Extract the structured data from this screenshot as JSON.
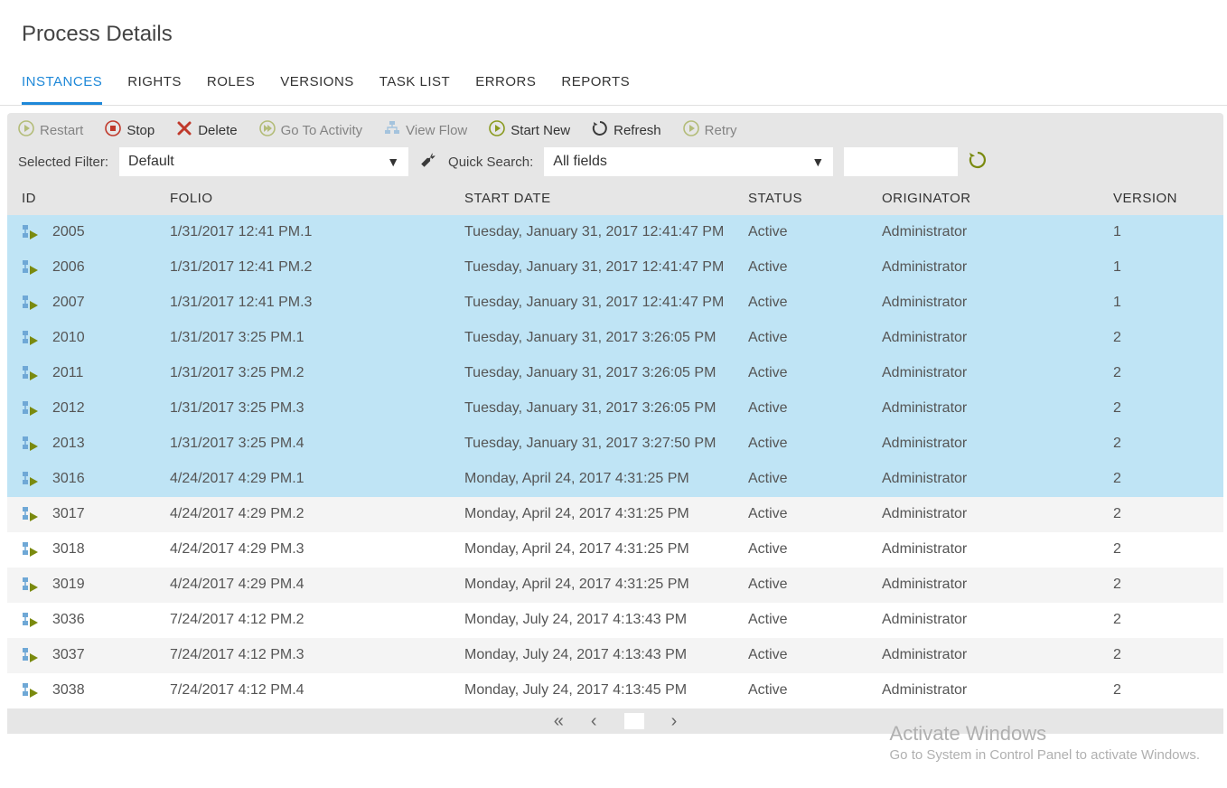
{
  "title": "Process Details",
  "tabs": [
    "INSTANCES",
    "RIGHTS",
    "ROLES",
    "VERSIONS",
    "TASK LIST",
    "ERRORS",
    "REPORTS"
  ],
  "activeTab": 0,
  "toolbar": {
    "restart": "Restart",
    "stop": "Stop",
    "delete": "Delete",
    "goto": "Go To Activity",
    "viewflow": "View Flow",
    "startnew": "Start New",
    "refresh": "Refresh",
    "retry": "Retry"
  },
  "filter": {
    "label": "Selected Filter:",
    "value": "Default"
  },
  "search": {
    "label": "Quick Search:",
    "fieldValue": "All fields",
    "inputValue": ""
  },
  "columns": {
    "id": "ID",
    "folio": "FOLIO",
    "start": "START DATE",
    "status": "STATUS",
    "originator": "ORIGINATOR",
    "version": "VERSION"
  },
  "rows": [
    {
      "id": "2005",
      "folio": "1/31/2017 12:41 PM.1",
      "start": "Tuesday, January 31, 2017 12:41:47 PM",
      "status": "Active",
      "originator": "Administrator",
      "version": "1",
      "selected": true
    },
    {
      "id": "2006",
      "folio": "1/31/2017 12:41 PM.2",
      "start": "Tuesday, January 31, 2017 12:41:47 PM",
      "status": "Active",
      "originator": "Administrator",
      "version": "1",
      "selected": true
    },
    {
      "id": "2007",
      "folio": "1/31/2017 12:41 PM.3",
      "start": "Tuesday, January 31, 2017 12:41:47 PM",
      "status": "Active",
      "originator": "Administrator",
      "version": "1",
      "selected": true
    },
    {
      "id": "2010",
      "folio": "1/31/2017 3:25 PM.1",
      "start": "Tuesday, January 31, 2017 3:26:05 PM",
      "status": "Active",
      "originator": "Administrator",
      "version": "2",
      "selected": true
    },
    {
      "id": "2011",
      "folio": "1/31/2017 3:25 PM.2",
      "start": "Tuesday, January 31, 2017 3:26:05 PM",
      "status": "Active",
      "originator": "Administrator",
      "version": "2",
      "selected": true
    },
    {
      "id": "2012",
      "folio": "1/31/2017 3:25 PM.3",
      "start": "Tuesday, January 31, 2017 3:26:05 PM",
      "status": "Active",
      "originator": "Administrator",
      "version": "2",
      "selected": true
    },
    {
      "id": "2013",
      "folio": "1/31/2017 3:25 PM.4",
      "start": "Tuesday, January 31, 2017 3:27:50 PM",
      "status": "Active",
      "originator": "Administrator",
      "version": "2",
      "selected": true
    },
    {
      "id": "3016",
      "folio": "4/24/2017 4:29 PM.1",
      "start": "Monday, April 24, 2017 4:31:25 PM",
      "status": "Active",
      "originator": "Administrator",
      "version": "2",
      "selected": true
    },
    {
      "id": "3017",
      "folio": "4/24/2017 4:29 PM.2",
      "start": "Monday, April 24, 2017 4:31:25 PM",
      "status": "Active",
      "originator": "Administrator",
      "version": "2",
      "selected": false
    },
    {
      "id": "3018",
      "folio": "4/24/2017 4:29 PM.3",
      "start": "Monday, April 24, 2017 4:31:25 PM",
      "status": "Active",
      "originator": "Administrator",
      "version": "2",
      "selected": false
    },
    {
      "id": "3019",
      "folio": "4/24/2017 4:29 PM.4",
      "start": "Monday, April 24, 2017 4:31:25 PM",
      "status": "Active",
      "originator": "Administrator",
      "version": "2",
      "selected": false
    },
    {
      "id": "3036",
      "folio": "7/24/2017 4:12 PM.2",
      "start": "Monday, July 24, 2017 4:13:43 PM",
      "status": "Active",
      "originator": "Administrator",
      "version": "2",
      "selected": false
    },
    {
      "id": "3037",
      "folio": "7/24/2017 4:12 PM.3",
      "start": "Monday, July 24, 2017 4:13:43 PM",
      "status": "Active",
      "originator": "Administrator",
      "version": "2",
      "selected": false
    },
    {
      "id": "3038",
      "folio": "7/24/2017 4:12 PM.4",
      "start": "Monday, July 24, 2017 4:13:45 PM",
      "status": "Active",
      "originator": "Administrator",
      "version": "2",
      "selected": false
    }
  ],
  "watermark": {
    "title": "Activate Windows",
    "sub": "Go to System in Control Panel to activate Windows."
  }
}
